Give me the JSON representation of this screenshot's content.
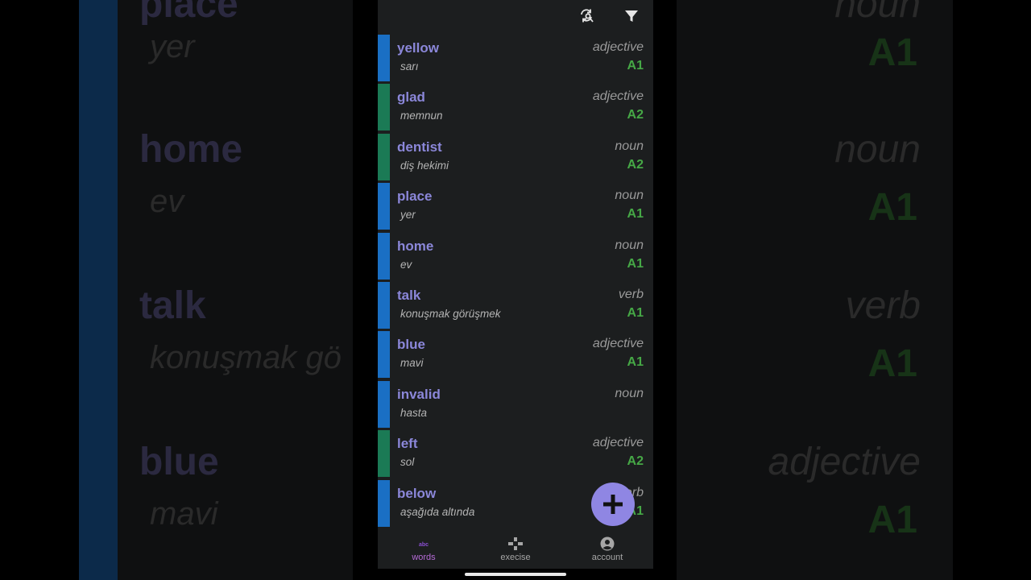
{
  "colors": {
    "accent": "#8f86e3",
    "word": "#8b87d9",
    "level": "#46a846",
    "strip_blue": "#1a6fc4",
    "strip_green": "#1b7a55",
    "active_nav": "#b56bd6"
  },
  "topbar": {
    "icons": [
      "sync-search-icon",
      "filter-icon"
    ]
  },
  "words": [
    {
      "word": "yellow",
      "translation": "sarı",
      "type": "adjective",
      "level": "A1",
      "strip": "blue"
    },
    {
      "word": "glad",
      "translation": "memnun",
      "type": "adjective",
      "level": "A2",
      "strip": "green"
    },
    {
      "word": "dentist",
      "translation": "diş hekimi",
      "type": "noun",
      "level": "A2",
      "strip": "green"
    },
    {
      "word": "place",
      "translation": "yer",
      "type": "noun",
      "level": "A1",
      "strip": "blue"
    },
    {
      "word": "home",
      "translation": "ev",
      "type": "noun",
      "level": "A1",
      "strip": "blue"
    },
    {
      "word": "talk",
      "translation": "konuşmak görüşmek",
      "type": "verb",
      "level": "A1",
      "strip": "blue"
    },
    {
      "word": "blue",
      "translation": "mavi",
      "type": "adjective",
      "level": "A1",
      "strip": "blue"
    },
    {
      "word": "invalid",
      "translation": "hasta",
      "type": "noun",
      "level": "",
      "strip": "blue"
    },
    {
      "word": "left",
      "translation": "sol",
      "type": "adjective",
      "level": "A2",
      "strip": "green"
    },
    {
      "word": "below",
      "translation": "aşağıda altında",
      "type": "verb",
      "level": "A1",
      "strip": "blue"
    }
  ],
  "fab": {
    "icon": "plus-icon"
  },
  "nav": {
    "words": "words",
    "exercise": "execise",
    "account": "account"
  },
  "background": {
    "left_words": [
      "place",
      "home",
      "talk",
      "blue"
    ],
    "left_translations": [
      "yer",
      "ev",
      "konuşmak gö",
      "mavi"
    ],
    "right_types": [
      "noun",
      "noun",
      "verb",
      "adjective"
    ],
    "right_levels": [
      "A1",
      "A1",
      "A1",
      "A1"
    ]
  }
}
